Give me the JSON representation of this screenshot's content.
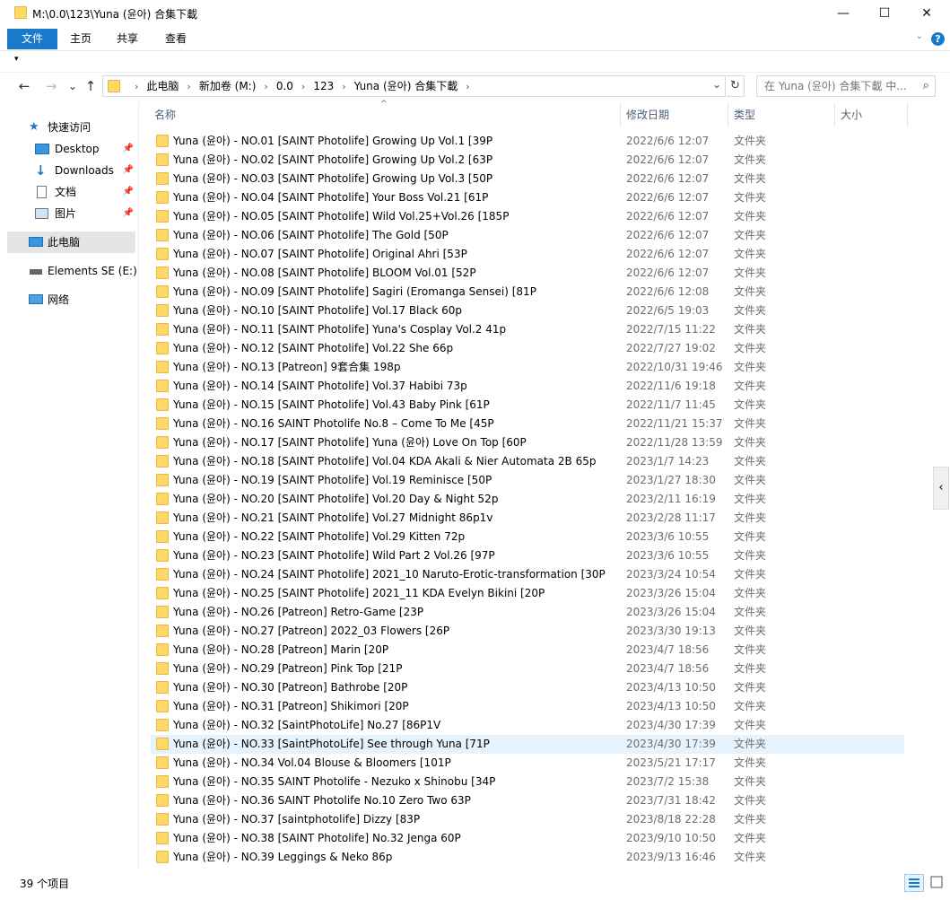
{
  "window": {
    "title": "M:\\0.0\\123\\Yuna (윤아) 合集下載",
    "minimize_icon": "—",
    "maximize_icon": "☐",
    "close_icon": "✕"
  },
  "ribbon": {
    "tabs": [
      "文件",
      "主页",
      "共享",
      "查看"
    ],
    "help": "?"
  },
  "qat": {
    "dropdown": "▾"
  },
  "nav": {
    "back": "←",
    "forward": "→",
    "recent": "⌄",
    "up": "↑"
  },
  "address": {
    "crumbs": [
      "此电脑",
      "新加卷 (M:)",
      "0.0",
      "123",
      "Yuna (윤아) 合集下載"
    ],
    "separator": "›"
  },
  "search": {
    "placeholder": "在 Yuna (윤아) 合集下載 中..."
  },
  "navpane": {
    "items": [
      {
        "label": "快速访问",
        "icon": "star-icon"
      },
      {
        "label": "Desktop",
        "icon": "desktop-icon",
        "pinned": true
      },
      {
        "label": "Downloads",
        "icon": "download-icon",
        "pinned": true
      },
      {
        "label": "文档",
        "icon": "document-icon",
        "pinned": true
      },
      {
        "label": "图片",
        "icon": "picture-icon",
        "pinned": true
      },
      {
        "label": "此电脑",
        "icon": "computer-icon"
      },
      {
        "label": "Elements SE (E:)",
        "icon": "drive-icon"
      },
      {
        "label": "网络",
        "icon": "network-icon"
      }
    ]
  },
  "columns": [
    "名称",
    "修改日期",
    "类型",
    "大小"
  ],
  "files": [
    {
      "name": "Yuna (윤아) - NO.01 [SAINT Photolife] Growing Up Vol.1 [39P",
      "date": "2022/6/6 12:07",
      "type": "文件夹"
    },
    {
      "name": "Yuna (윤아) - NO.02 [SAINT Photolife] Growing Up Vol.2 [63P",
      "date": "2022/6/6 12:07",
      "type": "文件夹"
    },
    {
      "name": "Yuna (윤아) - NO.03 [SAINT Photolife] Growing Up Vol.3 [50P",
      "date": "2022/6/6 12:07",
      "type": "文件夹"
    },
    {
      "name": "Yuna (윤아) - NO.04 [SAINT Photolife] Your Boss Vol.21 [61P",
      "date": "2022/6/6 12:07",
      "type": "文件夹"
    },
    {
      "name": "Yuna (윤아) - NO.05 [SAINT Photolife] Wild Vol.25+Vol.26 [185P",
      "date": "2022/6/6 12:07",
      "type": "文件夹"
    },
    {
      "name": "Yuna (윤아) - NO.06 [SAINT Photolife] The Gold [50P",
      "date": "2022/6/6 12:07",
      "type": "文件夹"
    },
    {
      "name": "Yuna (윤아) - NO.07 [SAINT Photolife] Original Ahri [53P",
      "date": "2022/6/6 12:07",
      "type": "文件夹"
    },
    {
      "name": "Yuna (윤아) - NO.08 [SAINT Photolife] BLOOM Vol.01 [52P",
      "date": "2022/6/6 12:07",
      "type": "文件夹"
    },
    {
      "name": "Yuna (윤아) - NO.09 [SAINT Photolife] Sagiri (Eromanga Sensei) [81P",
      "date": "2022/6/6 12:08",
      "type": "文件夹"
    },
    {
      "name": "Yuna (윤아) - NO.10 [SAINT Photolife] Vol.17 Black 60p",
      "date": "2022/6/5 19:03",
      "type": "文件夹"
    },
    {
      "name": "Yuna (윤아) - NO.11 [SAINT Photolife] Yuna's Cosplay Vol.2 41p",
      "date": "2022/7/15 11:22",
      "type": "文件夹"
    },
    {
      "name": "Yuna (윤아) - NO.12 [SAINT Photolife] Vol.22 She 66p",
      "date": "2022/7/27 19:02",
      "type": "文件夹"
    },
    {
      "name": "Yuna (윤아) - NO.13 [Patreon] 9套合集 198p",
      "date": "2022/10/31 19:46",
      "type": "文件夹"
    },
    {
      "name": "Yuna (윤아) - NO.14 [SAINT Photolife] Vol.37 Habibi 73p",
      "date": "2022/11/6 19:18",
      "type": "文件夹"
    },
    {
      "name": "Yuna (윤아) - NO.15 [SAINT Photolife] Vol.43 Baby Pink [61P",
      "date": "2022/11/7 11:45",
      "type": "文件夹"
    },
    {
      "name": "Yuna (윤아) - NO.16 SAINT Photolife No.8 – Come To Me [45P",
      "date": "2022/11/21 15:37",
      "type": "文件夹"
    },
    {
      "name": "Yuna (윤아) - NO.17 [SAINT Photolife] Yuna (윤아)  Love On Top [60P",
      "date": "2022/11/28 13:59",
      "type": "文件夹"
    },
    {
      "name": "Yuna (윤아) - NO.18 [SAINT Photolife] Vol.04 KDA Akali & Nier Automata 2B 65p",
      "date": "2023/1/7 14:23",
      "type": "文件夹"
    },
    {
      "name": "Yuna (윤아) - NO.19 [SAINT Photolife] Vol.19 Reminisce [50P",
      "date": "2023/1/27 18:30",
      "type": "文件夹"
    },
    {
      "name": "Yuna (윤아) - NO.20 [SAINT Photolife] Vol.20 Day & Night 52p",
      "date": "2023/2/11 16:19",
      "type": "文件夹"
    },
    {
      "name": "Yuna (윤아) - NO.21 [SAINT Photolife] Vol.27 Midnight 86p1v",
      "date": "2023/2/28 11:17",
      "type": "文件夹"
    },
    {
      "name": "Yuna (윤아) - NO.22 [SAINT Photolife] Vol.29 Kitten 72p",
      "date": "2023/3/6 10:55",
      "type": "文件夹"
    },
    {
      "name": "Yuna (윤아) - NO.23 [SAINT Photolife] Wild Part 2 Vol.26 [97P",
      "date": "2023/3/6 10:55",
      "type": "文件夹"
    },
    {
      "name": "Yuna (윤아) - NO.24 [SAINT Photolife] 2021_10 Naruto-Erotic-transformation [30P",
      "date": "2023/3/24 10:54",
      "type": "文件夹"
    },
    {
      "name": "Yuna (윤아) - NO.25 [SAINT Photolife] 2021_11 KDA Evelyn Bikini [20P",
      "date": "2023/3/26 15:04",
      "type": "文件夹"
    },
    {
      "name": "Yuna (윤아) - NO.26 [Patreon] Retro-Game [23P",
      "date": "2023/3/26 15:04",
      "type": "文件夹"
    },
    {
      "name": "Yuna (윤아) - NO.27 [Patreon] 2022_03 Flowers [26P",
      "date": "2023/3/30 19:13",
      "type": "文件夹"
    },
    {
      "name": "Yuna (윤아) - NO.28 [Patreon] Marin [20P",
      "date": "2023/4/7 18:56",
      "type": "文件夹"
    },
    {
      "name": "Yuna (윤아) - NO.29 [Patreon] Pink Top [21P",
      "date": "2023/4/7 18:56",
      "type": "文件夹"
    },
    {
      "name": "Yuna (윤아) - NO.30 [Patreon] Bathrobe [20P",
      "date": "2023/4/13 10:50",
      "type": "文件夹"
    },
    {
      "name": "Yuna (윤아) - NO.31 [Patreon] Shikimori [20P",
      "date": "2023/4/13 10:50",
      "type": "文件夹"
    },
    {
      "name": "Yuna (윤아) - NO.32 [SaintPhotoLife] No.27 [86P1V",
      "date": "2023/4/30 17:39",
      "type": "文件夹"
    },
    {
      "name": "Yuna (윤아) - NO.33 [SaintPhotoLife] See through Yuna [71P",
      "date": "2023/4/30 17:39",
      "type": "文件夹",
      "highlight": true
    },
    {
      "name": "Yuna (윤아) - NO.34 Vol.04 Blouse & Bloomers [101P",
      "date": "2023/5/21 17:17",
      "type": "文件夹"
    },
    {
      "name": "Yuna (윤아) - NO.35 SAINT Photolife - Nezuko x Shinobu [34P",
      "date": "2023/7/2 15:38",
      "type": "文件夹"
    },
    {
      "name": "Yuna (윤아) - NO.36 SAINT Photolife  No.10 Zero Two 63P",
      "date": "2023/7/31 18:42",
      "type": "文件夹"
    },
    {
      "name": "Yuna (윤아) - NO.37 [saintphotolife] Dizzy [83P",
      "date": "2023/8/18 22:28",
      "type": "文件夹"
    },
    {
      "name": "Yuna (윤아) - NO.38 [SAINT Photolife] No.32 Jenga 60P",
      "date": "2023/9/10 10:50",
      "type": "文件夹"
    },
    {
      "name": "Yuna (윤아) - NO.39 Leggings & Neko 86p",
      "date": "2023/9/13 16:46",
      "type": "文件夹"
    }
  ],
  "status": {
    "count": "39 个项目"
  },
  "colors": {
    "accent": "#1979ca",
    "folder": "#ffd966",
    "selection": "#e5f3ff",
    "navSelected": "#e5e5e5"
  }
}
